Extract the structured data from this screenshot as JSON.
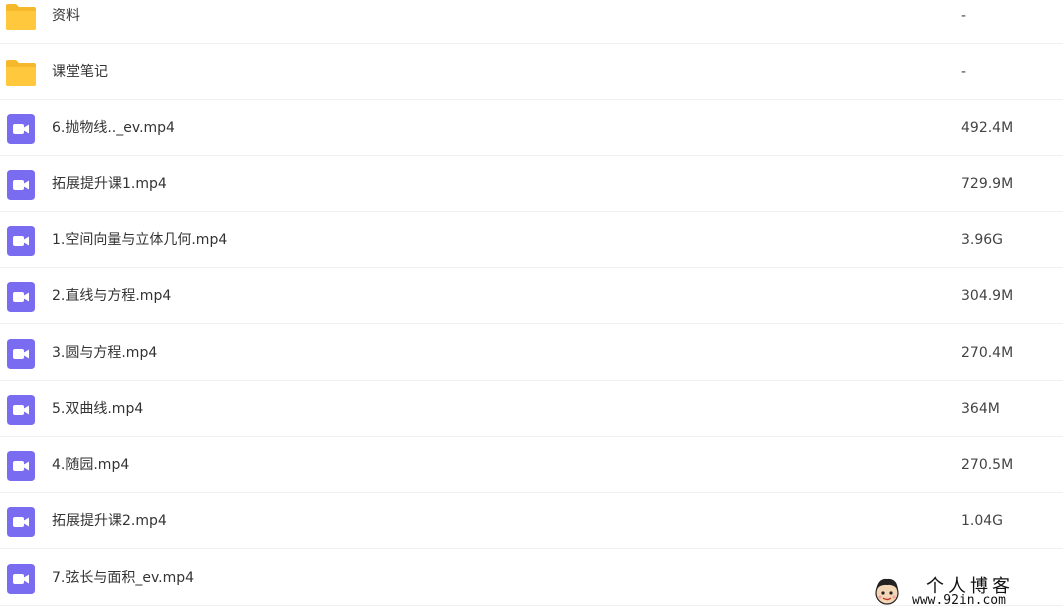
{
  "colors": {
    "folder": "#ffc83d",
    "folder_tab": "#f7b92c",
    "video": "#7a6cf0",
    "divider": "#f0f0f0",
    "text": "#333333"
  },
  "files": [
    {
      "name": "资料",
      "size": "-",
      "icon": "folder-icon"
    },
    {
      "name": "课堂笔记",
      "size": "-",
      "icon": "folder-icon"
    },
    {
      "name": "6.抛物线.._ev.mp4",
      "size": "492.4M",
      "icon": "video-file-icon"
    },
    {
      "name": "拓展提升课1.mp4",
      "size": "729.9M",
      "icon": "video-file-icon"
    },
    {
      "name": "1.空间向量与立体几何.mp4",
      "size": "3.96G",
      "icon": "video-file-icon"
    },
    {
      "name": "2.直线与方程.mp4",
      "size": "304.9M",
      "icon": "video-file-icon"
    },
    {
      "name": "3.圆与方程.mp4",
      "size": "270.4M",
      "icon": "video-file-icon"
    },
    {
      "name": "5.双曲线.mp4",
      "size": "364M",
      "icon": "video-file-icon"
    },
    {
      "name": "4.随园.mp4",
      "size": "270.5M",
      "icon": "video-file-icon"
    },
    {
      "name": "拓展提升课2.mp4",
      "size": "1.04G",
      "icon": "video-file-icon"
    },
    {
      "name": "7.弦长与面积_ev.mp4",
      "size": "",
      "icon": "video-file-icon"
    }
  ],
  "watermark": {
    "title": "个人博客",
    "url": "www.92in.com"
  }
}
